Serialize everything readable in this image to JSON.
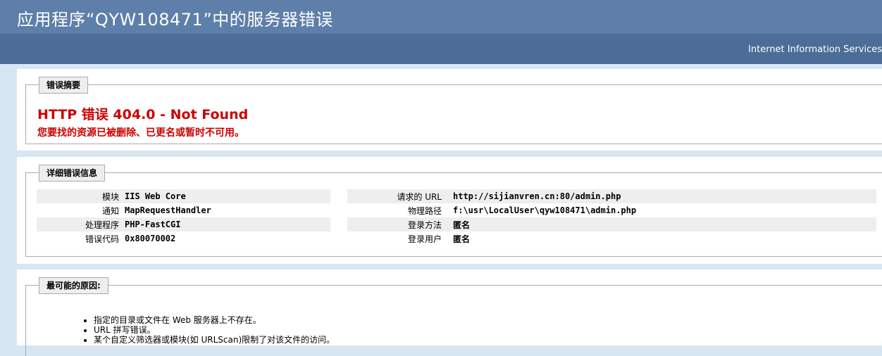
{
  "page": {
    "title": "应用程序“QYW108471”中的服务器错误",
    "product": "Internet Information Services"
  },
  "summary": {
    "legend": "错误摘要",
    "error_title": "HTTP 错误 404.0 - Not Found",
    "error_description": "您要找的资源已被删除、已更名或暂时不可用。"
  },
  "details": {
    "legend": "详细错误信息",
    "left": [
      {
        "label": "模块",
        "value": "IIS Web Core"
      },
      {
        "label": "通知",
        "value": "MapRequestHandler"
      },
      {
        "label": "处理程序",
        "value": "PHP-FastCGI"
      },
      {
        "label": "错误代码",
        "value": "0x80070002"
      }
    ],
    "right": [
      {
        "label": "请求的 URL",
        "value": "http://sijianvren.cn:80/admin.php"
      },
      {
        "label": "物理路径",
        "value": "f:\\usr\\LocalUser\\qyw108471\\admin.php"
      },
      {
        "label": "登录方法",
        "value": "匿名"
      },
      {
        "label": "登录用户",
        "value": "匿名"
      }
    ]
  },
  "causes": {
    "legend": "最可能的原因:",
    "items": [
      "指定的目录或文件在 Web 服务器上不存在。",
      "URL 拼写错误。",
      "某个自定义筛选器或模块(如 URLScan)限制了对该文件的访问。"
    ]
  }
}
